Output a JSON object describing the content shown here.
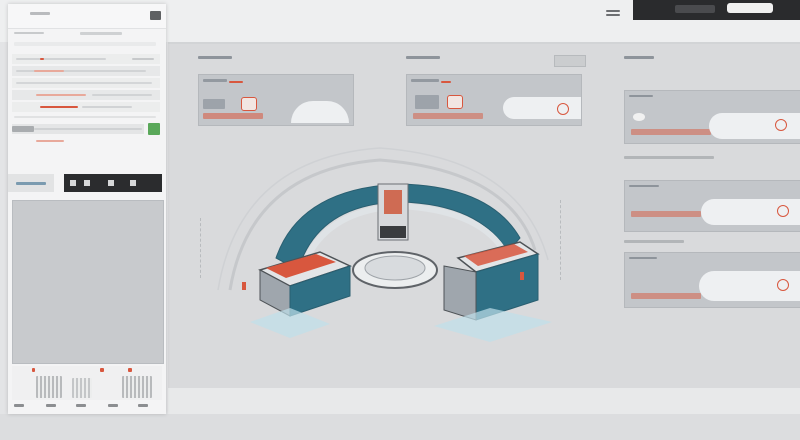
{
  "topbar": {
    "menu_labels": [
      "",
      ""
    ],
    "dark_controls": [
      "",
      ""
    ]
  },
  "left_panel": {
    "title": "",
    "rows": [
      "",
      "",
      "",
      "",
      "",
      "",
      ""
    ],
    "footer_tabs": [
      "",
      "",
      "",
      "",
      ""
    ]
  },
  "main": {
    "panels": [
      {
        "title": "",
        "subtitle": ""
      },
      {
        "title": "",
        "subtitle": ""
      },
      {
        "title": "",
        "subtitle": ""
      },
      {
        "title": "",
        "subtitle": ""
      }
    ]
  },
  "colors": {
    "accent_red": "#d8573e",
    "teal": "#2f7085",
    "panel_gray": "#c3c6ca",
    "dark": "#2a2b2d"
  }
}
